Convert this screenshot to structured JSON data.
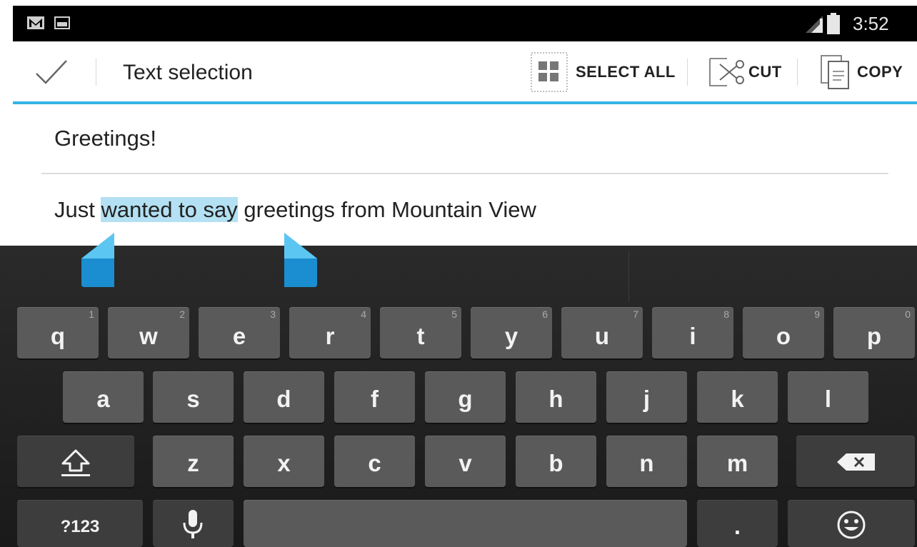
{
  "status_bar": {
    "time": "3:52",
    "icons": [
      "gmail-notification-icon",
      "image-notification-icon",
      "signal-icon",
      "battery-icon"
    ]
  },
  "action_bar": {
    "title": "Text selection",
    "actions": [
      {
        "label": "SELECT ALL",
        "icon": "select-all-icon"
      },
      {
        "label": "CUT",
        "icon": "cut-icon"
      },
      {
        "label": "COPY",
        "icon": "copy-icon"
      }
    ],
    "done_icon": "checkmark-icon"
  },
  "compose": {
    "subject": "Greetings!",
    "body_before": "Just ",
    "body_selected": "wanted to say",
    "body_after": " greetings from Mountain View"
  },
  "keyboard": {
    "row1": [
      {
        "key": "q",
        "hint": "1"
      },
      {
        "key": "w",
        "hint": "2"
      },
      {
        "key": "e",
        "hint": "3"
      },
      {
        "key": "r",
        "hint": "4"
      },
      {
        "key": "t",
        "hint": "5"
      },
      {
        "key": "y",
        "hint": "6"
      },
      {
        "key": "u",
        "hint": "7"
      },
      {
        "key": "i",
        "hint": "8"
      },
      {
        "key": "o",
        "hint": "9"
      },
      {
        "key": "p",
        "hint": "0"
      }
    ],
    "row2": [
      "a",
      "s",
      "d",
      "f",
      "g",
      "h",
      "j",
      "k",
      "l"
    ],
    "row3": [
      "z",
      "x",
      "c",
      "v",
      "b",
      "n",
      "m"
    ],
    "symbols_label": "?123",
    "period_label": ".",
    "icons": [
      "shift-icon",
      "backspace-icon",
      "microphone-icon",
      "emoji-icon"
    ]
  },
  "colors": {
    "accent": "#33b5e5",
    "selection": "#b3e0f2",
    "key": "#5a5a5a",
    "keyboard_bg": "#222222"
  }
}
